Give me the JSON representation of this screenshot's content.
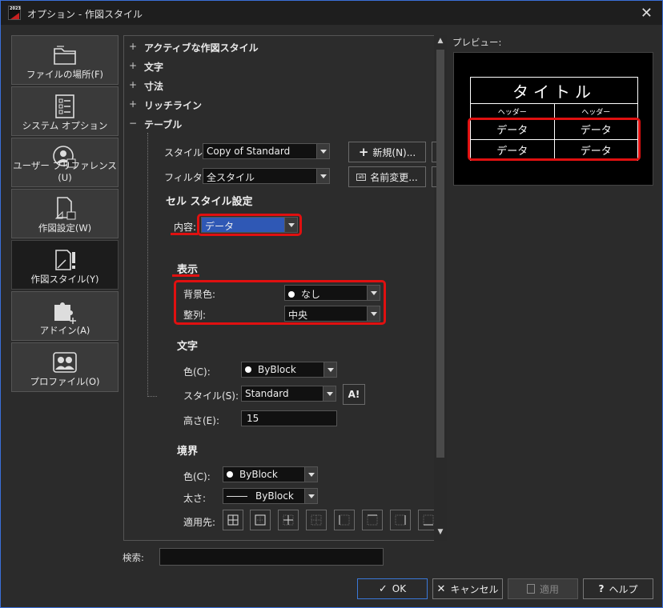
{
  "window": {
    "title": "オプション - 作図スタイル",
    "app_badge": "2023"
  },
  "nav": [
    {
      "label": "ファイルの場所(F)",
      "icon": "folder-icon"
    },
    {
      "label": "システム オプション",
      "icon": "checklist-icon"
    },
    {
      "label": "ユーザー プリファレンス(U)",
      "icon": "user-icon"
    },
    {
      "label": "作図設定(W)",
      "icon": "drafting-icon"
    },
    {
      "label": "作図スタイル(Y)",
      "icon": "style-icon",
      "active": true
    },
    {
      "label": "アドイン(A)",
      "icon": "puzzle-icon"
    },
    {
      "label": "プロファイル(O)",
      "icon": "profile-icon"
    }
  ],
  "tree": [
    {
      "sign": "+",
      "label": "アクティブな作図スタイル"
    },
    {
      "sign": "+",
      "label": "文字"
    },
    {
      "sign": "+",
      "label": "寸法"
    },
    {
      "sign": "+",
      "label": "リッチライン"
    },
    {
      "sign": "−",
      "label": "テーブル"
    }
  ],
  "table_style": {
    "style_label": "スタイル:",
    "style_value": "Copy of Standard",
    "filter_label": "フィルタ:",
    "filter_value": "全スタイル",
    "new_button": "新規(N)...",
    "rename_button": "名前変更..."
  },
  "cell_style": {
    "heading": "セル スタイル設定",
    "content_label": "内容:",
    "content_value": "データ"
  },
  "display": {
    "heading": "表示",
    "bg_label": "背景色:",
    "bg_value": "なし",
    "align_label": "整列:",
    "align_value": "中央"
  },
  "text": {
    "heading": "文字",
    "color_label": "色(C):",
    "color_value": "ByBlock",
    "style_label": "スタイル(S):",
    "style_value": "Standard",
    "height_label": "高さ(E):",
    "height_value": "15"
  },
  "border": {
    "heading": "境界",
    "color_label": "色(C):",
    "color_value": "ByBlock",
    "weight_label": "太さ:",
    "weight_value": "ByBlock",
    "apply_label": "適用先:"
  },
  "preview": {
    "label": "プレビュー:",
    "title": "タイトル",
    "header": "ヘッダー",
    "data": "データ"
  },
  "search": {
    "label": "検索:"
  },
  "footer": {
    "ok": "OK",
    "cancel": "キャンセル",
    "apply": "適用",
    "help": "ヘルプ"
  },
  "colors": {
    "highlight": "#e01010",
    "selection": "#2f58b5",
    "accent": "#3a6fd8"
  }
}
